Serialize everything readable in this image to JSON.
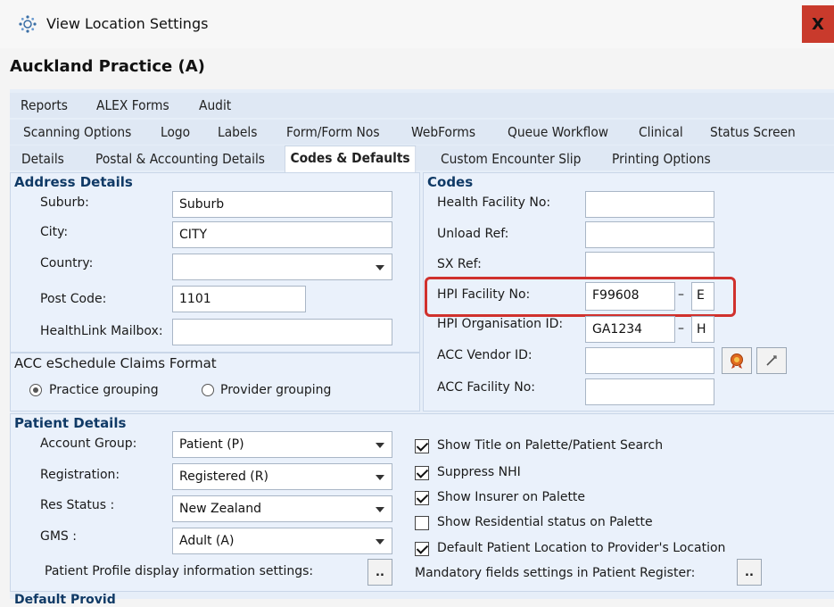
{
  "window": {
    "title": "View Location Settings",
    "close_label": "X"
  },
  "practice_name": "Auckland Practice (A)",
  "tabs": {
    "row1": [
      "Reports",
      "ALEX Forms",
      "Audit"
    ],
    "row2": [
      "Scanning Options",
      "Logo",
      "Labels",
      "Form/Form Nos",
      "WebForms",
      "Queue Workflow",
      "Clinical",
      "Status Screen"
    ],
    "row3": [
      "Details",
      "Postal & Accounting Details",
      "Codes & Defaults",
      "Custom Encounter Slip",
      "Printing Options"
    ],
    "active": "Codes & Defaults"
  },
  "address": {
    "title": "Address Details",
    "suburb_label": "Suburb:",
    "suburb_value": "Suburb",
    "city_label": "City:",
    "city_value": "CITY",
    "country_label": "Country:",
    "country_value": "",
    "postcode_label": "Post Code:",
    "postcode_value": "1101",
    "healthlink_label": "HealthLink Mailbox:",
    "healthlink_value": ""
  },
  "acc_format": {
    "title": "ACC eSchedule Claims Format",
    "option1": "Practice grouping",
    "option2": "Provider grouping",
    "selected": "Practice grouping"
  },
  "codes": {
    "title": "Codes",
    "health_facility_label": "Health Facility No:",
    "health_facility_value": "",
    "unload_ref_label": "Unload Ref:",
    "unload_ref_value": "",
    "sx_ref_label": "SX Ref:",
    "sx_ref_value": "",
    "hpi_facility_label": "HPI Facility No:",
    "hpi_facility_value": "F99608",
    "hpi_facility_check": "E",
    "hpi_org_label": "HPI Organisation ID:",
    "hpi_org_value": "GA1234",
    "hpi_org_check": "H",
    "acc_vendor_label": "ACC Vendor ID:",
    "acc_vendor_value": "",
    "acc_facility_label": "ACC Facility No:",
    "acc_facility_value": "",
    "dash": "–"
  },
  "patient": {
    "title": "Patient Details",
    "account_group_label": "Account Group:",
    "account_group_value": "Patient (P)",
    "registration_label": "Registration:",
    "registration_value": "Registered (R)",
    "res_status_label": "Res Status :",
    "res_status_value": "New Zealand",
    "gms_label": "GMS :",
    "gms_value": "Adult (A)",
    "profile_settings_label": "Patient Profile display information settings:",
    "mandatory_label": "Mandatory fields settings in Patient Register:",
    "ellipsis": "..",
    "checks": [
      {
        "label": "Show Title on Palette/Patient Search",
        "checked": true
      },
      {
        "label": "Suppress NHI",
        "checked": true
      },
      {
        "label": "Show Insurer on Palette",
        "checked": true
      },
      {
        "label": "Show Residential status on Palette",
        "checked": false
      },
      {
        "label": "Default Patient Location to Provider's Location",
        "checked": true
      }
    ]
  },
  "bottom_partial": "Default Provid"
}
